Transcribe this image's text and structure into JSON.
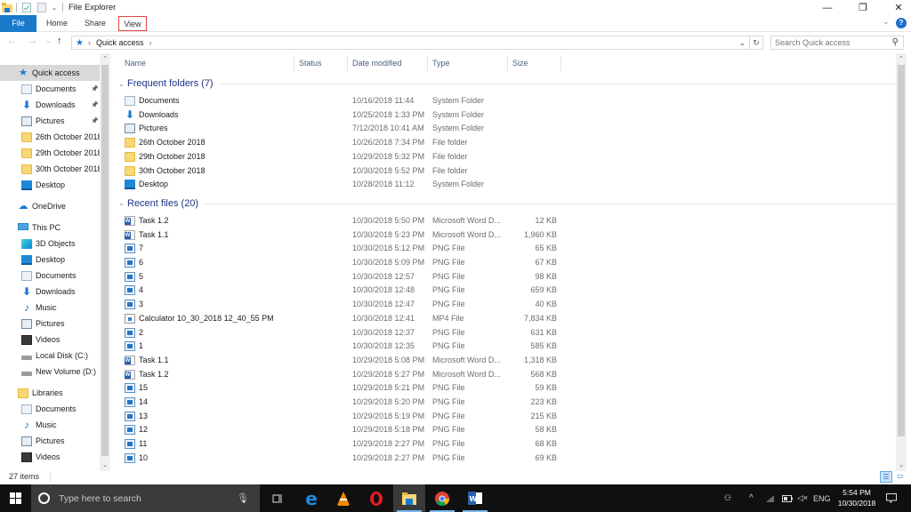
{
  "window": {
    "title": "File Explorer",
    "controls": {
      "minimize": "—",
      "restore": "❐",
      "close": "✕"
    }
  },
  "ribbon": {
    "tabs": [
      {
        "label": "File",
        "active": true
      },
      {
        "label": "Home"
      },
      {
        "label": "Share"
      },
      {
        "label": "View",
        "highlighted": true
      }
    ],
    "expand_icon": "⌄",
    "help_icon": "?"
  },
  "navigation": {
    "back": "←",
    "forward": "→",
    "recent": "⌄",
    "up": "↑",
    "breadcrumb": [
      "Quick access"
    ],
    "breadcrumb_sep": "›",
    "search_placeholder": "Search Quick access"
  },
  "nav_pane": {
    "items": [
      {
        "label": "Quick access",
        "icon": "star-icon",
        "selected": true,
        "level": 0
      },
      {
        "label": "Documents",
        "icon": "documents-icon",
        "pinned": true,
        "level": 1
      },
      {
        "label": "Downloads",
        "icon": "downloads-icon",
        "pinned": true,
        "level": 1
      },
      {
        "label": "Pictures",
        "icon": "pictures-icon",
        "pinned": true,
        "level": 1
      },
      {
        "label": "26th October 2018",
        "icon": "folder-icon",
        "level": 1
      },
      {
        "label": "29th October 2018",
        "icon": "folder-icon",
        "level": 1
      },
      {
        "label": "30th October 2018",
        "icon": "folder-icon",
        "level": 1
      },
      {
        "label": "Desktop",
        "icon": "desktop-icon",
        "level": 1
      },
      {
        "label": "OneDrive",
        "icon": "onedrive-icon",
        "level": 0
      },
      {
        "label": "This PC",
        "icon": "this-pc-icon",
        "level": 0
      },
      {
        "label": "3D Objects",
        "icon": "3d-objects-icon",
        "level": 1
      },
      {
        "label": "Desktop",
        "icon": "desktop-icon",
        "level": 1
      },
      {
        "label": "Documents",
        "icon": "documents-icon",
        "level": 1
      },
      {
        "label": "Downloads",
        "icon": "downloads-icon",
        "level": 1
      },
      {
        "label": "Music",
        "icon": "music-icon",
        "level": 1
      },
      {
        "label": "Pictures",
        "icon": "pictures-icon",
        "level": 1
      },
      {
        "label": "Videos",
        "icon": "videos-icon",
        "level": 1
      },
      {
        "label": "Local Disk (C:)",
        "icon": "local-disk-icon",
        "level": 1
      },
      {
        "label": "New Volume (D:)",
        "icon": "drive-icon",
        "level": 1
      },
      {
        "label": "Libraries",
        "icon": "libraries-icon",
        "level": 0
      },
      {
        "label": "Documents",
        "icon": "documents-icon",
        "level": 1
      },
      {
        "label": "Music",
        "icon": "music-icon",
        "level": 1
      },
      {
        "label": "Pictures",
        "icon": "pictures-icon",
        "level": 1
      },
      {
        "label": "Videos",
        "icon": "videos-icon",
        "level": 1
      }
    ]
  },
  "columns": [
    "Name",
    "Status",
    "Date modified",
    "Type",
    "Size"
  ],
  "groups": [
    {
      "title": "Frequent folders (7)",
      "rows": [
        {
          "name": "Documents",
          "icon": "documents-icon",
          "date": "10/16/2018 11:44",
          "type": "System Folder",
          "size": ""
        },
        {
          "name": "Downloads",
          "icon": "downloads-icon",
          "date": "10/25/2018 1:33 PM",
          "type": "System Folder",
          "size": ""
        },
        {
          "name": "Pictures",
          "icon": "pictures-icon",
          "date": "7/12/2018 10:41 AM",
          "type": "System Folder",
          "size": ""
        },
        {
          "name": "26th October 2018",
          "icon": "folder-icon",
          "date": "10/26/2018 7:34 PM",
          "type": "File folder",
          "size": ""
        },
        {
          "name": "29th October 2018",
          "icon": "folder-icon",
          "date": "10/29/2018 5:32 PM",
          "type": "File folder",
          "size": ""
        },
        {
          "name": "30th October 2018",
          "icon": "folder-icon",
          "date": "10/30/2018 5:52 PM",
          "type": "File folder",
          "size": ""
        },
        {
          "name": "Desktop",
          "icon": "desktop-icon",
          "date": "10/28/2018 11:12",
          "type": "System Folder",
          "size": ""
        }
      ]
    },
    {
      "title": "Recent files (20)",
      "rows": [
        {
          "name": "Task 1.2",
          "icon": "word-doc-icon",
          "date": "10/30/2018 5:50 PM",
          "type": "Microsoft Word D...",
          "size": "12 KB"
        },
        {
          "name": "Task 1.1",
          "icon": "word-doc-icon",
          "date": "10/30/2018 5:23 PM",
          "type": "Microsoft Word D...",
          "size": "1,960 KB"
        },
        {
          "name": "7",
          "icon": "png-file-icon",
          "date": "10/30/2018 5:12 PM",
          "type": "PNG File",
          "size": "65 KB"
        },
        {
          "name": "6",
          "icon": "png-file-icon",
          "date": "10/30/2018 5:09 PM",
          "type": "PNG File",
          "size": "67 KB"
        },
        {
          "name": "5",
          "icon": "png-file-icon",
          "date": "10/30/2018 12:57",
          "type": "PNG File",
          "size": "98 KB"
        },
        {
          "name": "4",
          "icon": "png-file-icon",
          "date": "10/30/2018 12:48",
          "type": "PNG File",
          "size": "659 KB"
        },
        {
          "name": "3",
          "icon": "png-file-icon",
          "date": "10/30/2018 12:47",
          "type": "PNG File",
          "size": "40 KB"
        },
        {
          "name": "Calculator 10_30_2018 12_40_55 PM",
          "icon": "mp4-file-icon",
          "date": "10/30/2018 12:41",
          "type": "MP4 File",
          "size": "7,834 KB"
        },
        {
          "name": "2",
          "icon": "png-file-icon",
          "date": "10/30/2018 12:37",
          "type": "PNG File",
          "size": "631 KB"
        },
        {
          "name": "1",
          "icon": "png-file-icon",
          "date": "10/30/2018 12:35",
          "type": "PNG File",
          "size": "585 KB"
        },
        {
          "name": "Task 1.1",
          "icon": "word-doc-icon",
          "date": "10/29/2018 5:08 PM",
          "type": "Microsoft Word D...",
          "size": "1,318 KB"
        },
        {
          "name": "Task 1.2",
          "icon": "word-doc-icon",
          "date": "10/29/2018 5:27 PM",
          "type": "Microsoft Word D...",
          "size": "568 KB"
        },
        {
          "name": "15",
          "icon": "png-file-icon",
          "date": "10/29/2018 5:21 PM",
          "type": "PNG File",
          "size": "59 KB"
        },
        {
          "name": "14",
          "icon": "png-file-icon",
          "date": "10/29/2018 5:20 PM",
          "type": "PNG File",
          "size": "223 KB"
        },
        {
          "name": "13",
          "icon": "png-file-icon",
          "date": "10/29/2018 5:19 PM",
          "type": "PNG File",
          "size": "215 KB"
        },
        {
          "name": "12",
          "icon": "png-file-icon",
          "date": "10/29/2018 5:18 PM",
          "type": "PNG File",
          "size": "58 KB"
        },
        {
          "name": "11",
          "icon": "png-file-icon",
          "date": "10/29/2018 2:27 PM",
          "type": "PNG File",
          "size": "68 KB"
        },
        {
          "name": "10",
          "icon": "png-file-icon",
          "date": "10/29/2018 2:27 PM",
          "type": "PNG File",
          "size": "69 KB"
        }
      ]
    }
  ],
  "status": {
    "item_count": "27 items"
  },
  "taskbar": {
    "search_placeholder": "Type here to search",
    "apps": [
      "task-view",
      "edge",
      "vlc",
      "opera",
      "file-explorer",
      "chrome",
      "word"
    ],
    "tray": {
      "language": "ENG",
      "time": "5:54 PM",
      "date": "10/30/2018"
    }
  },
  "colors": {
    "accent": "#1979ca",
    "group_header": "#1e3287",
    "taskbar": "#101010"
  }
}
